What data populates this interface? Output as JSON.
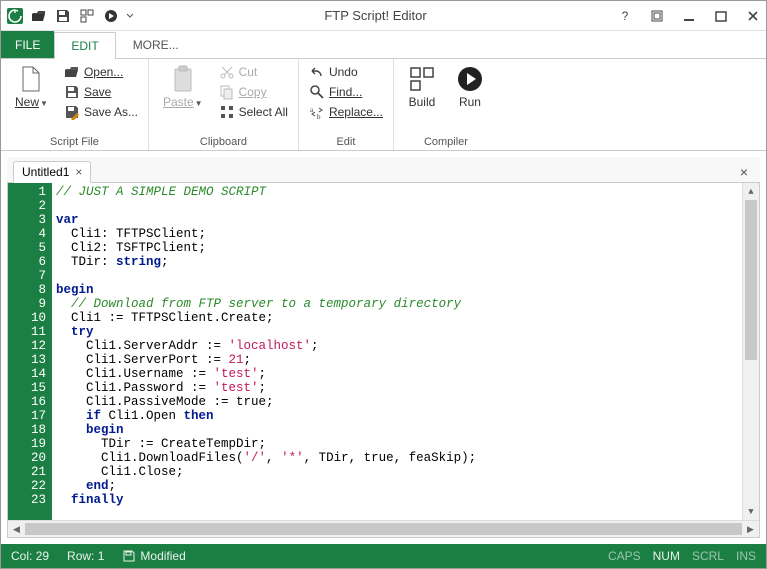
{
  "window": {
    "title": "FTP Script! Editor"
  },
  "tabs": {
    "file": "FILE",
    "edit": "EDIT",
    "more": "MORE..."
  },
  "ribbon": {
    "groups": {
      "scriptfile": {
        "label": "Script File",
        "new": "New",
        "open": "Open...",
        "save": "Save",
        "saveas": "Save As..."
      },
      "clipboard": {
        "label": "Clipboard",
        "paste": "Paste",
        "cut": "Cut",
        "copy": "Copy",
        "selectall": "Select All"
      },
      "edit": {
        "label": "Edit",
        "undo": "Undo",
        "find": "Find...",
        "replace": "Replace..."
      },
      "compiler": {
        "label": "Compiler",
        "build": "Build",
        "run": "Run"
      }
    }
  },
  "doc_tab": {
    "title": "Untitled1"
  },
  "code_lines": [
    {
      "n": 1,
      "segs": [
        {
          "c": "c-comment",
          "t": "// JUST A SIMPLE DEMO SCRIPT"
        }
      ]
    },
    {
      "n": 2,
      "segs": []
    },
    {
      "n": 3,
      "segs": [
        {
          "c": "c-kw",
          "t": "var"
        }
      ]
    },
    {
      "n": 4,
      "segs": [
        {
          "t": "  Cli1: TFTPSClient;"
        }
      ]
    },
    {
      "n": 5,
      "segs": [
        {
          "t": "  Cli2: TSFTPClient;"
        }
      ]
    },
    {
      "n": 6,
      "segs": [
        {
          "t": "  TDir: "
        },
        {
          "c": "c-kw",
          "t": "string"
        },
        {
          "t": ";"
        }
      ]
    },
    {
      "n": 7,
      "segs": []
    },
    {
      "n": 8,
      "segs": [
        {
          "c": "c-kw",
          "t": "begin"
        }
      ]
    },
    {
      "n": 9,
      "segs": [
        {
          "t": "  "
        },
        {
          "c": "c-comment",
          "t": "// Download from FTP server to a temporary directory"
        }
      ]
    },
    {
      "n": 10,
      "segs": [
        {
          "t": "  Cli1 := TFTPSClient.Create;"
        }
      ]
    },
    {
      "n": 11,
      "segs": [
        {
          "t": "  "
        },
        {
          "c": "c-kw",
          "t": "try"
        }
      ]
    },
    {
      "n": 12,
      "segs": [
        {
          "t": "    Cli1.ServerAddr := "
        },
        {
          "c": "c-str",
          "t": "'localhost'"
        },
        {
          "t": ";"
        }
      ]
    },
    {
      "n": 13,
      "segs": [
        {
          "t": "    Cli1.ServerPort := "
        },
        {
          "c": "c-num",
          "t": "21"
        },
        {
          "t": ";"
        }
      ]
    },
    {
      "n": 14,
      "segs": [
        {
          "t": "    Cli1.Username := "
        },
        {
          "c": "c-str",
          "t": "'test'"
        },
        {
          "t": ";"
        }
      ]
    },
    {
      "n": 15,
      "segs": [
        {
          "t": "    Cli1.Password := "
        },
        {
          "c": "c-str",
          "t": "'test'"
        },
        {
          "t": ";"
        }
      ]
    },
    {
      "n": 16,
      "segs": [
        {
          "t": "    Cli1.PassiveMode := true;"
        }
      ]
    },
    {
      "n": 17,
      "segs": [
        {
          "t": "    "
        },
        {
          "c": "c-kw",
          "t": "if"
        },
        {
          "t": " Cli1.Open "
        },
        {
          "c": "c-kw",
          "t": "then"
        }
      ]
    },
    {
      "n": 18,
      "segs": [
        {
          "t": "    "
        },
        {
          "c": "c-kw",
          "t": "begin"
        }
      ]
    },
    {
      "n": 19,
      "segs": [
        {
          "t": "      TDir := CreateTempDir;"
        }
      ]
    },
    {
      "n": 20,
      "segs": [
        {
          "t": "      Cli1.DownloadFiles("
        },
        {
          "c": "c-str",
          "t": "'/'"
        },
        {
          "t": ", "
        },
        {
          "c": "c-str",
          "t": "'*'"
        },
        {
          "t": ", TDir, true, feaSkip);"
        }
      ]
    },
    {
      "n": 21,
      "segs": [
        {
          "t": "      Cli1.Close;"
        }
      ]
    },
    {
      "n": 22,
      "segs": [
        {
          "t": "    "
        },
        {
          "c": "c-kw",
          "t": "end"
        },
        {
          "t": ";"
        }
      ]
    },
    {
      "n": 23,
      "segs": [
        {
          "t": "  "
        },
        {
          "c": "c-kw",
          "t": "finally"
        }
      ]
    }
  ],
  "status": {
    "col_label": "Col:",
    "col_val": "29",
    "row_label": "Row:",
    "row_val": "1",
    "modified": "Modified",
    "caps": "CAPS",
    "num": "NUM",
    "scrl": "SCRL",
    "ins": "INS"
  }
}
